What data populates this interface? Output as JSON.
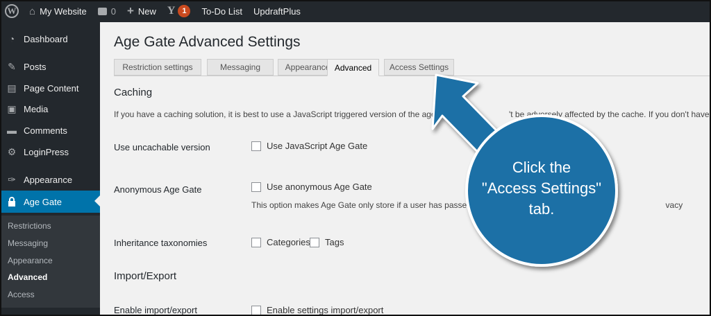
{
  "adminbar": {
    "site_name": "My Website",
    "comments_count": "0",
    "new_label": "New",
    "notifications_count": "1",
    "todo_label": "To-Do List",
    "updraft_label": "UpdraftPlus"
  },
  "sidebar": {
    "items": [
      {
        "label": "Dashboard",
        "icon": "dashboard-icon"
      },
      {
        "label": "Posts",
        "icon": "pin-icon"
      },
      {
        "label": "Page Content",
        "icon": "page-icon"
      },
      {
        "label": "Media",
        "icon": "media-icon"
      },
      {
        "label": "Comments",
        "icon": "comment-icon"
      },
      {
        "label": "LoginPress",
        "icon": "gear-icon"
      },
      {
        "label": "Appearance",
        "icon": "brush-icon"
      },
      {
        "label": "Age Gate",
        "icon": "lock-icon"
      }
    ],
    "submenu": [
      "Restrictions",
      "Messaging",
      "Appearance",
      "Advanced",
      "Access"
    ],
    "current_submenu": "Advanced",
    "accent_color": "#0073aa"
  },
  "page": {
    "title": "Age Gate Advanced Settings",
    "tabs": [
      "Restriction settings",
      "Messaging",
      "Appearance",
      "Advanced",
      "Access Settings"
    ],
    "active_tab": "Advanced"
  },
  "caching": {
    "title": "Caching",
    "description": "If you have a caching solution, it is best to use a JavaScript triggered version of the age gate as t",
    "description_tail": "'t be adversely affected by the cache. If you don't have caching",
    "uncachable_label": "Use uncachable version",
    "uncachable_option": "Use JavaScript Age Gate",
    "anonymous_label": "Anonymous Age Gate",
    "anonymous_option": "Use anonymous Age Gate",
    "anonymous_note": "This option makes Age Gate only store if a user has passed t",
    "anonymous_note_tail": "vacy",
    "taxonomies_label": "Inheritance taxonomies",
    "taxonomy_options": [
      "Categories",
      "Tags"
    ]
  },
  "import_export": {
    "title": "Import/Export",
    "enable_label": "Enable import/export",
    "enable_option": "Enable settings import/export"
  },
  "callout": {
    "line1": "Click the",
    "line2": "\"Access Settings\"",
    "line3": "tab.",
    "color": "#1b6fa6"
  }
}
